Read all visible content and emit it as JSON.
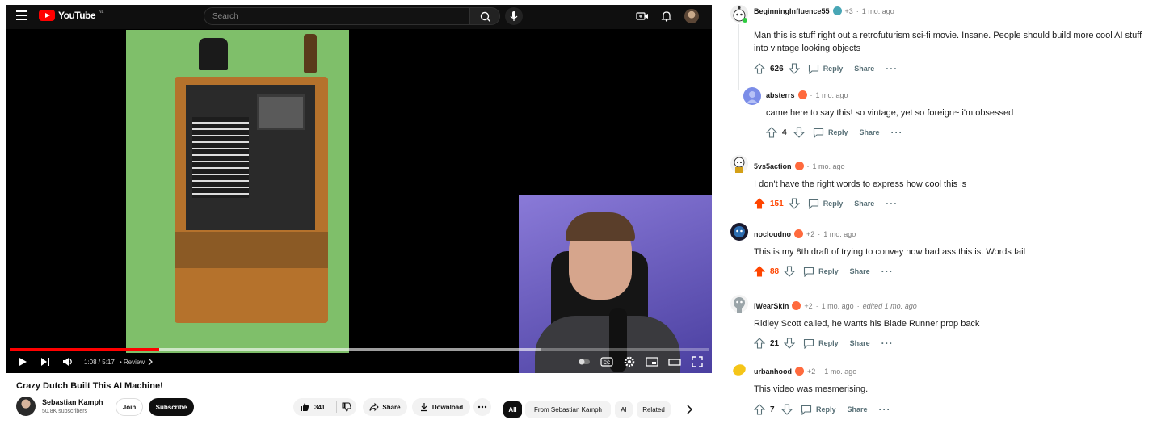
{
  "youtube": {
    "logo_text": "YouTube",
    "logo_country": "NL",
    "search_placeholder": "Search",
    "timecode": "1:08 / 5:17",
    "chapter": "• Review",
    "progress": 0.214,
    "buffered": 0.76,
    "video_title": "Crazy Dutch Built This AI Machine!",
    "channel_name": "Sebastian Kamph",
    "subscribers": "50.8K subscribers",
    "join_label": "Join",
    "subscribe_label": "Subscribe",
    "like_count": "341",
    "share_label": "Share",
    "download_label": "Download",
    "chips": [
      "All",
      "From Sebastian Kamph",
      "AI",
      "Related"
    ]
  },
  "reddit": {
    "comments": [
      {
        "username": "BeginningInfluence55",
        "extra_flairs": "+3",
        "time": "1 mo. ago",
        "edited": "",
        "body": "Man this is stuff right out a retrofuturism sci-fi movie. Insane. People should build more cool AI stuff into vintage looking objects",
        "votes": "626",
        "upvoted": false,
        "reply_label": "Reply",
        "share_label": "Share"
      },
      {
        "username": "absterrs",
        "extra_flairs": "",
        "time": "1 mo. ago",
        "edited": "",
        "body": "came here to say this! so vintage, yet so foreign~ i'm obsessed",
        "votes": "4",
        "upvoted": false,
        "reply_label": "Reply",
        "share_label": "Share"
      },
      {
        "username": "5vs5action",
        "extra_flairs": "",
        "time": "1 mo. ago",
        "edited": "",
        "body": "I don't have the right words to express how cool this is",
        "votes": "151",
        "upvoted": true,
        "reply_label": "Reply",
        "share_label": "Share"
      },
      {
        "username": "nocloudno",
        "extra_flairs": "+2",
        "time": "1 mo. ago",
        "edited": "",
        "body": "This is my 8th draft of trying to convey how bad ass this is. Words fail",
        "votes": "88",
        "upvoted": true,
        "reply_label": "Reply",
        "share_label": "Share"
      },
      {
        "username": "IWearSkin",
        "extra_flairs": "+2",
        "time": "1 mo. ago",
        "edited": "edited 1 mo. ago",
        "body": "Ridley Scott called, he wants his Blade Runner prop back",
        "votes": "21",
        "upvoted": false,
        "reply_label": "Reply",
        "share_label": "Share"
      },
      {
        "username": "urbanhood",
        "extra_flairs": "+2",
        "time": "1 mo. ago",
        "edited": "",
        "body": "This video was mesmerising.",
        "votes": "7",
        "upvoted": false,
        "reply_label": "Reply",
        "share_label": "Share"
      }
    ],
    "colors": {
      "upvote_active": "#ff4500",
      "text": "#1c1c1c",
      "meta": "#7c7c7c",
      "action": "#576f76"
    }
  }
}
